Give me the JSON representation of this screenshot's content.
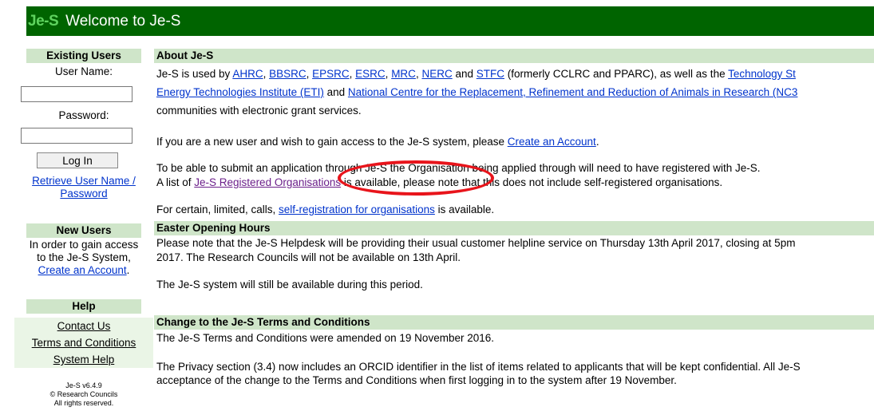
{
  "header": {
    "logo": "Je-S",
    "title": "Welcome to Je-S"
  },
  "sidebar": {
    "existing_users": {
      "heading": "Existing Users",
      "username_label": "User Name:",
      "password_label": "Password:",
      "login_button": "Log In",
      "retrieve_line1": "Retrieve User Name /",
      "retrieve_line2": "Password"
    },
    "new_users": {
      "heading": "New Users",
      "line1": "In order to gain access",
      "line2": "to the Je-S System,",
      "create_account": "Create an Account",
      "period": "."
    },
    "help": {
      "heading": "Help",
      "items": [
        "Contact Us",
        "Terms and Conditions",
        "System Help"
      ]
    },
    "footer": {
      "version": "Je-S v6.4.9",
      "copyright": "© Research Councils",
      "rights": "All rights reserved."
    }
  },
  "main": {
    "about": {
      "heading": "About Je-S",
      "l1_pre": "Je-S is used by ",
      "links1": [
        "AHRC",
        "BBSRC",
        "EPSRC",
        "ESRC",
        "MRC",
        "NERC"
      ],
      "l1_and": " and ",
      "stfc": "STFC",
      "l1_post": " (formerly CCLRC and PPARC), as well as the ",
      "tech_link": "Technology St",
      "eti_link": "Energy Technologies Institute (ETI)",
      "l2_and": " and ",
      "nc3_link": "National Centre for the Replacement, Refinement and Reduction of Animals in Research (NC3",
      "l3": "communities with electronic grant services.",
      "new_user_pre": "If you are a new user and wish to gain access to the Je-S system, please ",
      "create_account": "Create an Account",
      "period": ".",
      "submit_line": "To be able to submit an application through Je-S the Organisation being applied through will need to have registered with Je-S.",
      "list_pre": "A list of ",
      "registered_link": "Je-S Registered Organisations",
      "list_post": " is available, please note that this does not include self-registered organisations.",
      "limited_pre": "For certain, limited, calls, ",
      "selfreg_link": "self-registration for organisations",
      "limited_post": " is available."
    },
    "easter": {
      "heading": "Easter Opening Hours",
      "l1": "Please note that the Je-S Helpdesk will be providing their usual customer helpline service on Thursday 13th April 2017, closing at 5pm",
      "l2": "2017. The Research Councils will not be available on 13th April.",
      "l3": "The Je-S system will still be available during this period."
    },
    "terms": {
      "heading": "Change to the Je-S Terms and Conditions",
      "l1": "The Je-S Terms and Conditions were amended on 19 November 2016.",
      "l2": "The Privacy section (3.4) now includes an ORCID identifier in the list of items related to applicants that will be kept confidential. All Je-S",
      "l3": "acceptance of the change to the Terms and Conditions when first logging in to the system after 19 November."
    }
  },
  "colors": {
    "header_bg": "#006400",
    "section_bg": "#cfe5c9",
    "link": "#0033cc",
    "highlight_ring": "#e8141b"
  }
}
